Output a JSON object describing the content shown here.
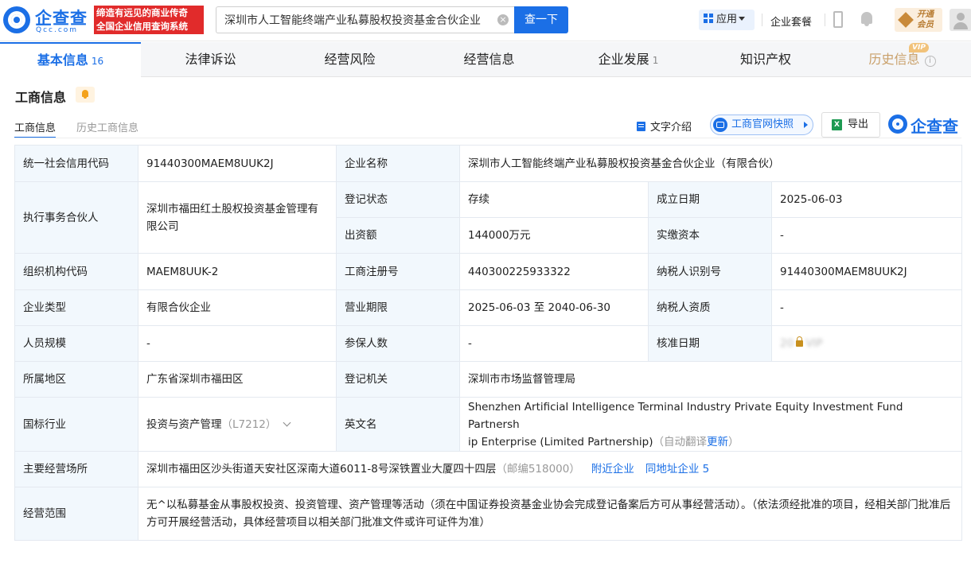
{
  "brand": {
    "logo_text": "企查查",
    "logo_sub": "Qcc.com",
    "slogan_line1": "缔造有远见的商业传奇",
    "slogan_line2": "全国企业信用查询系统"
  },
  "search": {
    "value": "深圳市人工智能终端产业私募股权投资基金合伙企业（",
    "button": "查一下"
  },
  "header": {
    "app_label": "应用",
    "package_label": "企业套餐",
    "member_line1": "开通",
    "member_line2": "会员"
  },
  "nav": {
    "tabs": [
      {
        "label": "基本信息",
        "count": "16"
      },
      {
        "label": "法律诉讼",
        "count": ""
      },
      {
        "label": "经营风险",
        "count": ""
      },
      {
        "label": "经营信息",
        "count": ""
      },
      {
        "label": "企业发展",
        "count": "1"
      },
      {
        "label": "知识产权",
        "count": ""
      },
      {
        "label": "历史信息",
        "count": ""
      }
    ],
    "vip_badge": "VIP",
    "info_mark": "i"
  },
  "section": {
    "title": "工商信息",
    "subtab_active": "工商信息",
    "subtab_inactive": "历史工商信息",
    "text_intro": "文字介绍",
    "snapshot": "工商官网快照",
    "export": "导出",
    "export_icon": "X",
    "logo_text": "企查查"
  },
  "info": {
    "credit_code_label": "统一社会信用代码",
    "credit_code": "91440300MAEM8UUK2J",
    "name_label": "企业名称",
    "name": "深圳市人工智能终端产业私募股权投资基金合伙企业（有限合伙）",
    "partner_label": "执行事务合伙人",
    "partner": "深圳市福田红土股权投资基金管理有限公司",
    "status_label": "登记状态",
    "status": "存续",
    "found_label": "成立日期",
    "found": "2025-06-03",
    "capital_label": "出资额",
    "capital": "144000万元",
    "paid_label": "实缴资本",
    "paid": "-",
    "org_code_label": "组织机构代码",
    "org_code": "MAEM8UUK-2",
    "reg_no_label": "工商注册号",
    "reg_no": "440300225933322",
    "tax_id_label": "纳税人识别号",
    "tax_id": "91440300MAEM8UUK2J",
    "type_label": "企业类型",
    "type": "有限合伙企业",
    "term_label": "营业期限",
    "term": "2025-06-03 至 2040-06-30",
    "tax_qual_label": "纳税人资质",
    "tax_qual": "-",
    "staff_label": "人员规模",
    "staff": "-",
    "insured_label": "参保人数",
    "insured": "-",
    "approve_label": "核准日期",
    "approve_blur_left": "20",
    "approve_blur_right": "VIP",
    "region_label": "所属地区",
    "region": "广东省深圳市福田区",
    "authority_label": "登记机关",
    "authority": "深圳市市场监督管理局",
    "industry_label": "国标行业",
    "industry": "投资与资产管理",
    "industry_code": "（L7212）",
    "en_name_label": "英文名",
    "en_name_line1": "Shenzhen Artificial Intelligence Terminal Industry Private Equity Investment Fund Partnersh",
    "en_name_line2": "ip Enterprise (Limited Partnership)",
    "auto_translate": "（自动翻译",
    "update": "更新",
    "close_paren": "）",
    "address_label": "主要经营场所",
    "address": "深圳市福田区沙头街道天安社区深南大道6011-8号深铁置业大厦四十四层",
    "postcode": "（邮编518000）",
    "nearby": "附近企业",
    "same_address": "同地址企业 5",
    "scope_label": "经营范围",
    "scope": "无^以私募基金从事股权投资、投资管理、资产管理等活动（须在中国证券投资基金业协会完成登记备案后方可从事经营活动）。（依法须经批准的项目，经相关部门批准后方可开展经营活动，具体经营项目以相关部门批准文件或许可证件为准）"
  }
}
